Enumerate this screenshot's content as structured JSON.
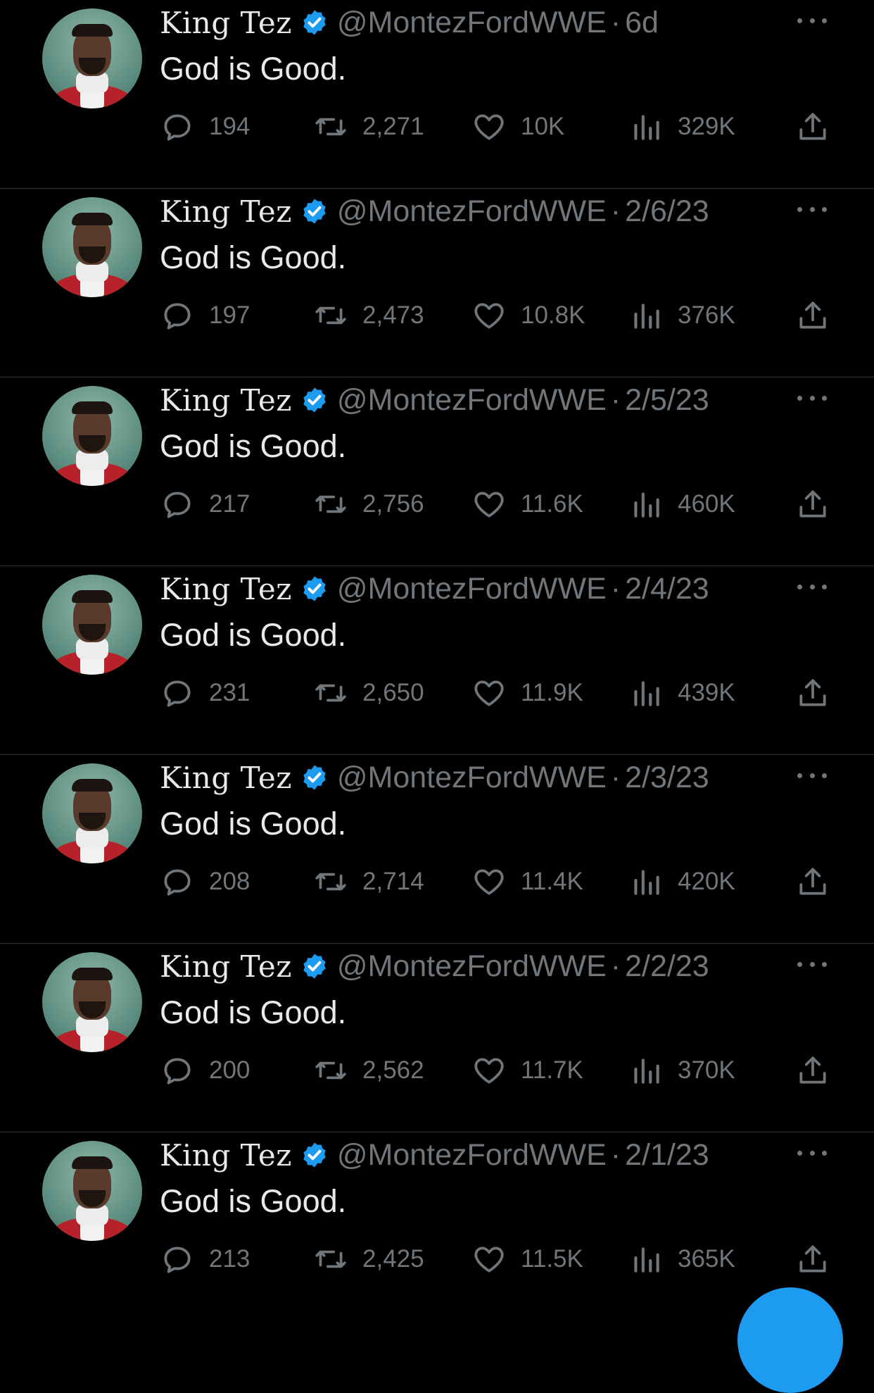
{
  "colors": {
    "background": "#000000",
    "text": "#e7e9ea",
    "secondary": "#71767b",
    "accent": "#1d9bf0",
    "divider": "#2f3336"
  },
  "tweets": [
    {
      "name": "King Tez",
      "handle": "@MontezFordWWE",
      "time": "6d",
      "text": "God is Good.",
      "replies": "194",
      "retweets": "2,271",
      "likes": "10K",
      "views": "329K"
    },
    {
      "name": "King Tez",
      "handle": "@MontezFordWWE",
      "time": "2/6/23",
      "text": "God is Good.",
      "replies": "197",
      "retweets": "2,473",
      "likes": "10.8K",
      "views": "376K"
    },
    {
      "name": "King Tez",
      "handle": "@MontezFordWWE",
      "time": "2/5/23",
      "text": "God is Good.",
      "replies": "217",
      "retweets": "2,756",
      "likes": "11.6K",
      "views": "460K"
    },
    {
      "name": "King Tez",
      "handle": "@MontezFordWWE",
      "time": "2/4/23",
      "text": "God is Good.",
      "replies": "231",
      "retweets": "2,650",
      "likes": "11.9K",
      "views": "439K"
    },
    {
      "name": "King Tez",
      "handle": "@MontezFordWWE",
      "time": "2/3/23",
      "text": "God is Good.",
      "replies": "208",
      "retweets": "2,714",
      "likes": "11.4K",
      "views": "420K"
    },
    {
      "name": "King Tez",
      "handle": "@MontezFordWWE",
      "time": "2/2/23",
      "text": "God is Good.",
      "replies": "200",
      "retweets": "2,562",
      "likes": "11.7K",
      "views": "370K"
    },
    {
      "name": "King Tez",
      "handle": "@MontezFordWWE",
      "time": "2/1/23",
      "text": "God is Good.",
      "replies": "213",
      "retweets": "2,425",
      "likes": "11.5K",
      "views": "365K"
    }
  ],
  "separator": "·",
  "icons": {
    "verified": "verified-badge-icon",
    "more": "more-options-icon",
    "reply": "reply-icon",
    "retweet": "retweet-icon",
    "like": "heart-icon",
    "views": "views-icon",
    "share": "share-icon",
    "compose": "compose-button"
  }
}
